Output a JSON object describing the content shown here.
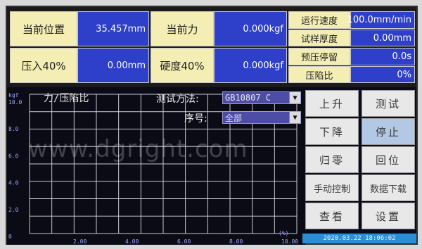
{
  "readouts": {
    "position_label": "当前位置",
    "position_value": "35.457mm",
    "force_label": "当前力",
    "force_value": "0.000kgf",
    "indent40_label": "压入40%",
    "indent40_value": "0.00mm",
    "hardness40_label": "硬度40%",
    "hardness40_value": "0.000kgf"
  },
  "params": {
    "speed_label": "运行速度",
    "speed_value": "100.0mm/min",
    "thickness_label": "试样厚度",
    "thickness_value": "0.00mm",
    "dwell_label": "预压停留",
    "dwell_value": "0.0s",
    "ratio_label": "压陷比",
    "ratio_value": "0%"
  },
  "chart_data": {
    "type": "line",
    "title": "力/压陷比",
    "ylabel": "kgf",
    "xlabel": "(%)",
    "y_ticks": [
      "10.0",
      "8.0",
      "6.0",
      "4.0",
      "2.0",
      "0"
    ],
    "x_ticks": [
      "2.00",
      "4.00",
      "6.00",
      "8.00",
      "10.00"
    ],
    "ylim": [
      0,
      10
    ],
    "xlim": [
      0,
      10
    ],
    "grid": true,
    "series": []
  },
  "controls": {
    "method_label": "测试方法:",
    "method_value": "GB10807 C",
    "seq_label": "序号:",
    "seq_value": "全部"
  },
  "buttons": {
    "up": "上升",
    "test": "测试",
    "down": "下降",
    "stop": "停止",
    "zero": "归零",
    "return": "回位",
    "manual": "手动控制",
    "download": "数据下载",
    "view": "查看",
    "settings": "设置"
  },
  "datetime": "2020.03.22 18:06:02",
  "watermark": "www.dgright.com"
}
